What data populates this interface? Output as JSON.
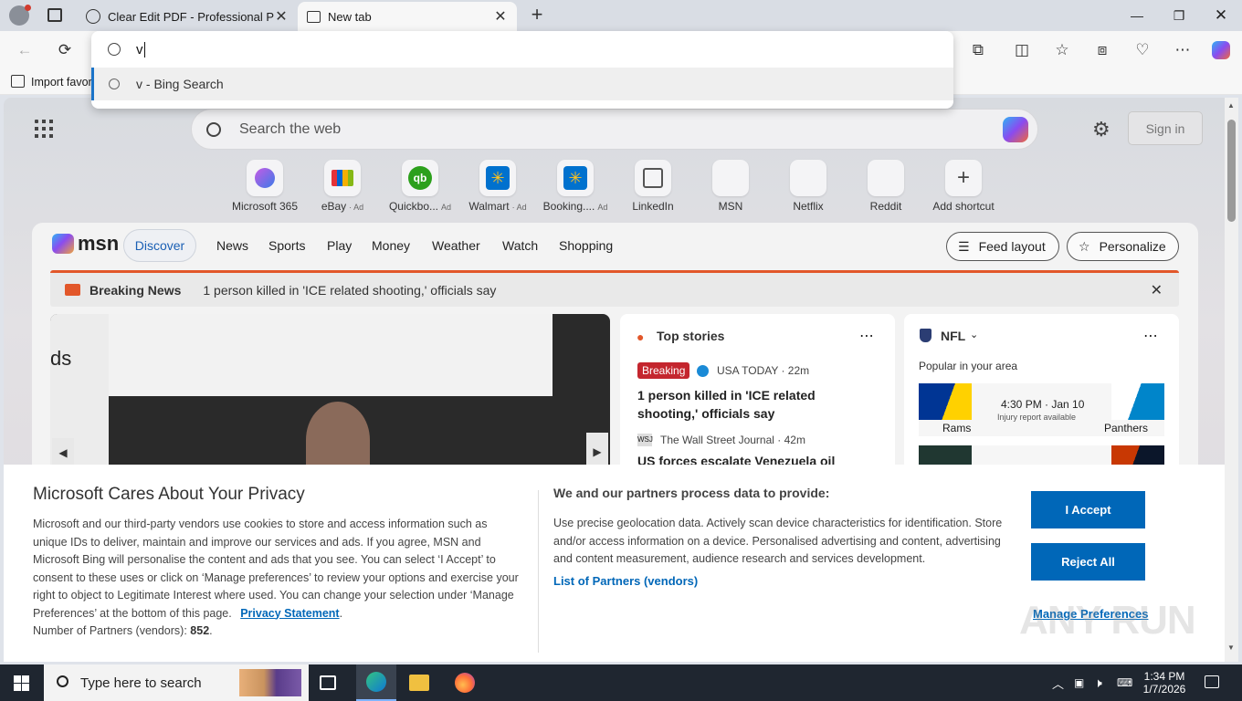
{
  "browser": {
    "tabs": [
      {
        "title": "Clear Edit PDF - Professional PDF",
        "active": false
      },
      {
        "title": "New tab",
        "active": true
      }
    ],
    "favorites_bar": {
      "import_label": "Import favor"
    }
  },
  "omnibox": {
    "value": "v",
    "suggestion": "v - Bing Search"
  },
  "newtab": {
    "search_placeholder": "Search the web",
    "sign_in": "Sign in",
    "shortcuts": [
      {
        "label": "Microsoft 365",
        "ad": ""
      },
      {
        "label": "eBay",
        "ad": "· Ad"
      },
      {
        "label": "Quickbo...",
        "ad": "Ad"
      },
      {
        "label": "Walmart",
        "ad": "· Ad"
      },
      {
        "label": "Booking....",
        "ad": "Ad"
      },
      {
        "label": "LinkedIn",
        "ad": ""
      },
      {
        "label": "MSN",
        "ad": ""
      },
      {
        "label": "Netflix",
        "ad": ""
      },
      {
        "label": "Reddit",
        "ad": ""
      },
      {
        "label": "Add shortcut",
        "ad": ""
      }
    ]
  },
  "msn": {
    "logo": "msn",
    "nav": [
      "Discover",
      "News",
      "Sports",
      "Play",
      "Money",
      "Weather",
      "Watch",
      "Shopping"
    ],
    "feed_layout": "Feed layout",
    "personalize": "Personalize",
    "breaking_label": "Breaking News",
    "breaking_text": "1 person killed in 'ICE related shooting,' officials say",
    "hero_text": "ds",
    "top_stories": {
      "title": "Top stories",
      "badge": "Breaking",
      "source1": "USA TODAY · 22m",
      "headline1": "1 person killed in 'ICE related shooting,' officials say",
      "source2": "The Wall Street Journal · 42m",
      "headline2": "US forces escalate Venezuela oil"
    },
    "nfl": {
      "title": "NFL",
      "subtitle": "Popular in your area",
      "game_time": "4:30 PM · Jan 10",
      "injury": "Injury report available",
      "team1": "Rams",
      "team2": "Panthers"
    }
  },
  "privacy": {
    "title": "Microsoft Cares About Your Privacy",
    "body": "Microsoft and our third-party vendors use cookies to store and access information such as unique IDs to deliver, maintain and improve our services and ads. If you agree, MSN and Microsoft Bing will personalise the content and ads that you see. You can select ‘I Accept’ to consent to these uses or click on ‘Manage preferences’ to review your options and exercise your right to object to Legitimate Interest where used.  You can change your selection under ‘Manage Preferences’ at the bottom of this page.",
    "privacy_link": "Privacy Statement",
    "partners_label": "Number of Partners (vendors): ",
    "partners_count": "852",
    "right_title": "We and our partners process data to provide:",
    "right_body": "Use precise geolocation data. Actively scan device characteristics for identification. Store and/or access information on a device. Personalised advertising and content, advertising and content measurement, audience research and services development.",
    "partners_link": "List of Partners (vendors)",
    "accept": "I Accept",
    "reject": "Reject All",
    "manage": "Manage Preferences"
  },
  "taskbar": {
    "search_placeholder": "Type here to search",
    "time": "1:34 PM",
    "date": "1/7/2026"
  },
  "watermark": "ANY RUN",
  "colors": {
    "accent": "#0067b8",
    "breaking": "#e2572a",
    "badge_red": "#c4262e"
  }
}
